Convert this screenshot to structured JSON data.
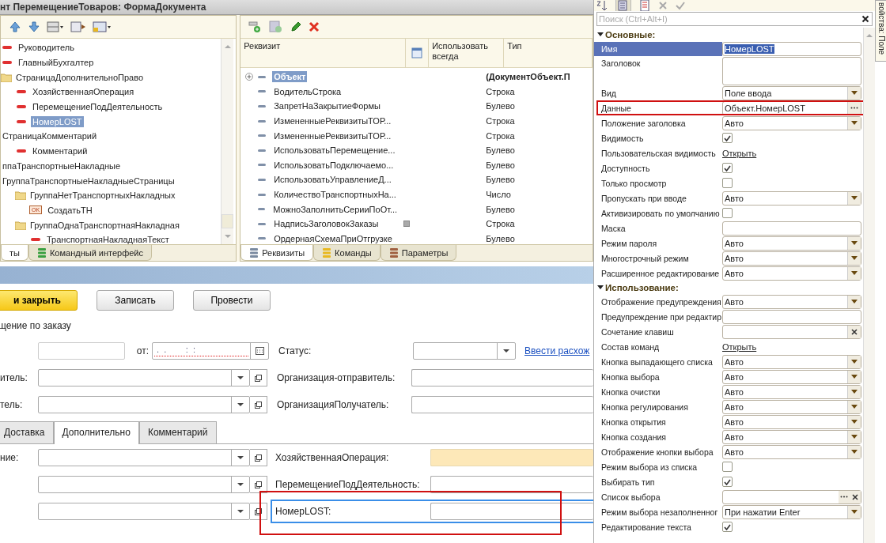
{
  "window": {
    "title": "нт ПеремещениеТоваров: ФормаДокумента"
  },
  "tree": [
    {
      "kind": "attr",
      "label": "Руководитель",
      "selected": false
    },
    {
      "kind": "attr",
      "label": "ГлавныйБухгалтер",
      "selected": false
    },
    {
      "kind": "folder",
      "label": "СтраницаДополнительноПраво",
      "selected": false,
      "children": [
        {
          "kind": "attr",
          "label": "ХозяйственнаяОперация",
          "selected": false
        },
        {
          "kind": "attr",
          "label": "ПеремещениеПодДеятельность",
          "selected": false
        },
        {
          "kind": "attr",
          "label": "НомерLOST",
          "selected": true
        }
      ]
    },
    {
      "kind": "group",
      "label": "СтраницаКомментарий",
      "selected": false,
      "children": [
        {
          "kind": "attr",
          "label": "Комментарий",
          "selected": false
        }
      ]
    },
    {
      "kind": "group",
      "label": "ппаТранспортныеНакладные",
      "selected": false
    },
    {
      "kind": "group",
      "label": "ГруппаТранспортныеНакладныеСтраницы",
      "selected": false,
      "children": [
        {
          "kind": "folder",
          "label": "ГруппаНетТранспортныхНакладных",
          "selected": false,
          "children": [
            {
              "kind": "button",
              "label": "СоздатьТН",
              "selected": false,
              "badge": "OK"
            }
          ]
        },
        {
          "kind": "folder",
          "label": "ГруппаОднаТранспортнаяНакладная",
          "selected": false,
          "children": [
            {
              "kind": "attr",
              "label": "ТранспортнаяНакладнаяТекст",
              "selected": false
            }
          ]
        }
      ]
    }
  ],
  "left_tabs": [
    {
      "label": "ты",
      "selected": true
    },
    {
      "label": "Командный интерфейс",
      "selected": false
    }
  ],
  "attributes": {
    "columns": [
      "Реквизит",
      "Использовать всегда",
      "Тип"
    ],
    "rows": [
      {
        "name": "Объект",
        "type": "(ДокументОбъект.П",
        "expandable": true,
        "selected": true,
        "flag": false
      },
      {
        "name": "ВодительСтрока",
        "type": "Строка",
        "expandable": false,
        "selected": false,
        "flag": false
      },
      {
        "name": "ЗапретНаЗакрытиеФормы",
        "type": "Булево",
        "expandable": false,
        "selected": false,
        "flag": false
      },
      {
        "name": "ИзмененныеРеквизитыТОР...",
        "type": "Строка",
        "expandable": false,
        "selected": false,
        "flag": false
      },
      {
        "name": "ИзмененныеРеквизитыТОР...",
        "type": "Строка",
        "expandable": false,
        "selected": false,
        "flag": false
      },
      {
        "name": "ИспользоватьПеремещение...",
        "type": "Булево",
        "expandable": false,
        "selected": false,
        "flag": false
      },
      {
        "name": "ИспользоватьПодключаемо...",
        "type": "Булево",
        "expandable": false,
        "selected": false,
        "flag": false
      },
      {
        "name": "ИспользоватьУправлениеД...",
        "type": "Булево",
        "expandable": false,
        "selected": false,
        "flag": false
      },
      {
        "name": "КоличествоТранспортныхНа...",
        "type": "Число",
        "expandable": false,
        "selected": false,
        "flag": false
      },
      {
        "name": "МожноЗаполнитьСерииПоОт...",
        "type": "Булево",
        "expandable": false,
        "selected": false,
        "flag": false
      },
      {
        "name": "НадписьЗаголовокЗаказы",
        "type": "Строка",
        "expandable": false,
        "selected": false,
        "flag": true
      },
      {
        "name": "ОрдернаяСхемаПриОтгрузке",
        "type": "Булево",
        "expandable": false,
        "selected": false,
        "flag": false
      }
    ]
  },
  "middle_tabs": [
    {
      "label": "Реквизиты",
      "selected": true,
      "color": "#7a8aa0"
    },
    {
      "label": "Команды",
      "selected": false,
      "color": "#e8b820"
    },
    {
      "label": "Параметры",
      "selected": false,
      "color": "#a06040"
    }
  ],
  "properties": {
    "search": {
      "placeholder": "Поиск (Ctrl+Alt+I)"
    },
    "sections": [
      {
        "title": "Основные:",
        "expanded": true,
        "rows": [
          {
            "label": "Имя",
            "kind": "text",
            "value": "НомерLOST",
            "selected": true
          },
          {
            "label": "Заголовок",
            "kind": "textarea",
            "selected": false
          },
          {
            "label": "Вид",
            "kind": "select",
            "value": "Поле ввода",
            "selected": false
          },
          {
            "label": "Данные",
            "kind": "choice",
            "value": "Объект.НомерLOST",
            "selected": false
          },
          {
            "label": "Положение заголовка",
            "kind": "select",
            "value": "Авто",
            "selected": false
          },
          {
            "label": "Видимость",
            "kind": "check",
            "checked": true,
            "selected": false
          },
          {
            "label": "Пользовательская видимость",
            "kind": "link",
            "value": "Открыть",
            "selected": false
          },
          {
            "label": "Доступность",
            "kind": "check",
            "checked": true,
            "selected": false
          },
          {
            "label": "Только просмотр",
            "kind": "check",
            "checked": false,
            "selected": false
          },
          {
            "label": "Пропускать при вводе",
            "kind": "select",
            "value": "Авто",
            "selected": false
          },
          {
            "label": "Активизировать по умолчанию",
            "kind": "check",
            "checked": false,
            "selected": false
          },
          {
            "label": "Маска",
            "kind": "text",
            "selected": false
          },
          {
            "label": "Режим пароля",
            "kind": "select",
            "value": "Авто",
            "selected": false
          },
          {
            "label": "Многострочный режим",
            "kind": "select",
            "value": "Авто",
            "selected": false
          },
          {
            "label": "Расширенное редактирование",
            "kind": "select",
            "value": "Авто",
            "selected": false
          }
        ]
      },
      {
        "title": "Использование:",
        "expanded": true,
        "rows": [
          {
            "label": "Отображение предупреждения",
            "kind": "select",
            "value": "Авто",
            "selected": false
          },
          {
            "label": "Предупреждение при редактир",
            "kind": "text",
            "selected": false
          },
          {
            "label": "Сочетание клавиш",
            "kind": "clear",
            "selected": false
          },
          {
            "label": "Состав команд",
            "kind": "link",
            "value": "Открыть",
            "selected": false
          },
          {
            "label": "Кнопка выпадающего списка",
            "kind": "select",
            "value": "Авто",
            "selected": false
          },
          {
            "label": "Кнопка выбора",
            "kind": "select",
            "value": "Авто",
            "selected": false
          },
          {
            "label": "Кнопка очистки",
            "kind": "select",
            "value": "Авто",
            "selected": false
          },
          {
            "label": "Кнопка регулирования",
            "kind": "select",
            "value": "Авто",
            "selected": false
          },
          {
            "label": "Кнопка открытия",
            "kind": "select",
            "value": "Авто",
            "selected": false
          },
          {
            "label": "Кнопка создания",
            "kind": "select",
            "value": "Авто",
            "selected": false
          },
          {
            "label": "Отображение кнопки выбора",
            "kind": "select",
            "value": "Авто",
            "selected": false
          },
          {
            "label": "Режим выбора из списка",
            "kind": "check",
            "checked": false,
            "selected": false
          },
          {
            "label": "Выбирать тип",
            "kind": "check",
            "checked": true,
            "selected": false
          },
          {
            "label": "Список выбора",
            "kind": "choice_clear",
            "selected": false
          },
          {
            "label": "Режим выбора незаполненног",
            "kind": "select",
            "value": "При нажатии Enter",
            "selected": false
          },
          {
            "label": "Редактирование текста",
            "kind": "check",
            "checked": true,
            "selected": false
          }
        ]
      }
    ],
    "side_tab": "войства: Поле"
  },
  "form": {
    "buttons": [
      {
        "label": "и закрыть",
        "kind": "primary"
      },
      {
        "label": "Записать",
        "kind": "plain"
      },
      {
        "label": "Провести",
        "kind": "plain"
      }
    ],
    "title": "щение по заказу",
    "date_label": "от:",
    "date_mask": " .  .        :  :",
    "status_label": "Статус:",
    "link": "Ввести расхож",
    "rows": [
      {
        "label": "итель:",
        "right_label": "Организация-отправитель:"
      },
      {
        "label": "тель:",
        "right_label": "ОрганизацияПолучатель:"
      }
    ],
    "tabs": [
      {
        "label": "Доставка",
        "selected": false
      },
      {
        "label": "Дополнительно",
        "selected": true
      },
      {
        "label": "Комментарий",
        "selected": false
      }
    ],
    "tab_rows": [
      {
        "label": "ние:",
        "right_label": "ХозяйственнаяОперация:",
        "highlighted": true,
        "focused": false
      },
      {
        "right_label": "ПеремещениеПодДеятельность:",
        "highlighted": false,
        "focused": false
      },
      {
        "right_label": "НомерLOST:",
        "highlighted": false,
        "focused": true
      }
    ]
  }
}
